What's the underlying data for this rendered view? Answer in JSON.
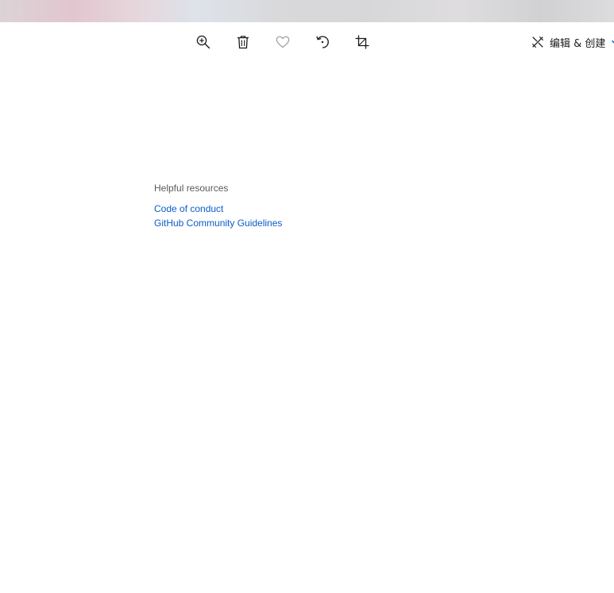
{
  "toolbar": {
    "zoom_icon": "zoom-in-icon",
    "delete_icon": "trash-icon",
    "favorite_icon": "heart-icon",
    "rotate_icon": "rotate-icon",
    "crop_icon": "crop-icon",
    "edit_create_label": "编辑 & 创建",
    "edit_create_icon": "edit-create-icon",
    "accent_color": "#0b5cc8"
  },
  "resources": {
    "heading": "Helpful resources",
    "links": [
      {
        "label": "Code of conduct"
      },
      {
        "label": "GitHub Community Guidelines"
      }
    ],
    "link_color": "#0b5cc8"
  }
}
